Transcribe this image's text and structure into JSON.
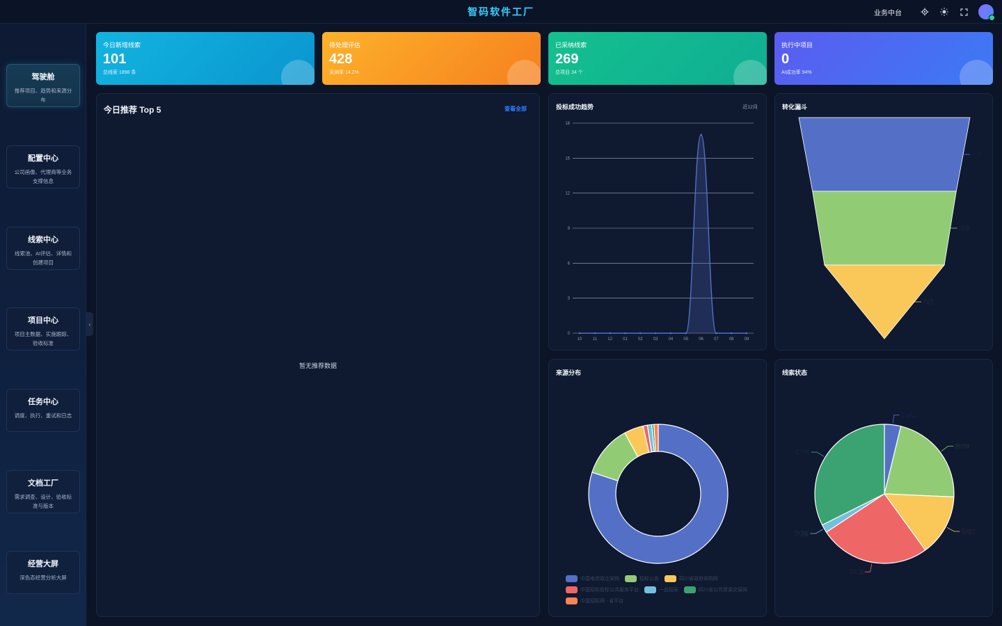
{
  "app": {
    "title": "智码软件工厂"
  },
  "topbar": {
    "workspace_link": "业务中台",
    "icons": [
      "gear-icon",
      "sun-icon",
      "fullscreen-icon"
    ]
  },
  "sidebar": {
    "items": [
      {
        "title": "驾驶舱",
        "desc": "推荐项目、趋势和来源分布",
        "active": true
      },
      {
        "title": "配置中心",
        "desc": "公司画像、代理商等业务支撑信息"
      },
      {
        "title": "线索中心",
        "desc": "线索池、AI评估、详情和创建项目"
      },
      {
        "title": "项目中心",
        "desc": "项目主数据、实施跟踪、验收标准"
      },
      {
        "title": "任务中心",
        "desc": "调度、执行、重试和日志"
      },
      {
        "title": "文档工厂",
        "desc": "需求调查、设计、验收标准与版本"
      },
      {
        "title": "经营大屏",
        "desc": "深色态经营分析大屏"
      }
    ]
  },
  "kpis": [
    {
      "label": "今日新增线索",
      "value": "101",
      "sub": "总线索 1898 条",
      "color_from": "#12b4e0",
      "color_to": "#0a95cf"
    },
    {
      "label": "待处理评估",
      "value": "428",
      "sub": "采纳率 14.2%",
      "color_from": "#fdb22a",
      "color_to": "#f6801f"
    },
    {
      "label": "已采纳线索",
      "value": "269",
      "sub": "总项目 34 个",
      "color_from": "#14c08e",
      "color_to": "#0fae94"
    },
    {
      "label": "执行中项目",
      "value": "0",
      "sub": "AI成功率 94%",
      "color_from": "#5b5cf0",
      "color_to": "#3b7af4"
    }
  ],
  "recommend": {
    "title": "今日推荐 Top 5",
    "link": "查看全部",
    "empty": "暂无推荐数据"
  },
  "trend": {
    "title": "投标成功趋势",
    "note": "近12月",
    "chart_data": {
      "type": "line",
      "x": [
        "10",
        "11",
        "12",
        "01",
        "02",
        "03",
        "04",
        "05",
        "06",
        "07",
        "08",
        "09"
      ],
      "series": [
        {
          "values": [
            0,
            0,
            0,
            0,
            0,
            0,
            0,
            0,
            17,
            0,
            0,
            0
          ]
        }
      ],
      "ylim": [
        0,
        18
      ],
      "yticks": [
        0,
        3,
        6,
        9,
        12,
        15,
        18
      ],
      "color": "#5470c6"
    }
  },
  "funnel": {
    "title": "转化漏斗",
    "chart_data": {
      "type": "funnel",
      "stages": [
        {
          "label": "线索",
          "color": "#5470c6"
        },
        {
          "label": "评估",
          "color": "#91cc75"
        },
        {
          "label": "采纳",
          "color": "#fac858"
        }
      ]
    }
  },
  "source": {
    "title": "来源分布",
    "chart_data": {
      "type": "pie",
      "donut": true,
      "categories": [
        "中国电信政企采购",
        "招标公告",
        "四川省政府采购网",
        "中国招标投标公共服务平台",
        "一品招采",
        "四川省公共资源交易网",
        "中国招标网 - 省平台"
      ],
      "values": [
        80,
        12,
        4.5,
        1,
        1,
        0.5,
        1
      ],
      "colors": [
        "#5470c6",
        "#91cc75",
        "#fac858",
        "#ee6666",
        "#73c0de",
        "#3ba272",
        "#fc8452"
      ]
    }
  },
  "status": {
    "title": "线索状态",
    "chart_data": {
      "type": "pie",
      "categories": [
        "已创建",
        "待评估",
        "已采纳",
        "已驳回",
        "已归档",
        "已评估"
      ],
      "values": [
        4,
        23,
        15,
        27,
        2,
        34
      ],
      "colors": [
        "#5470c6",
        "#91cc75",
        "#fac858",
        "#ee6666",
        "#73c0de",
        "#3ba272"
      ]
    }
  }
}
